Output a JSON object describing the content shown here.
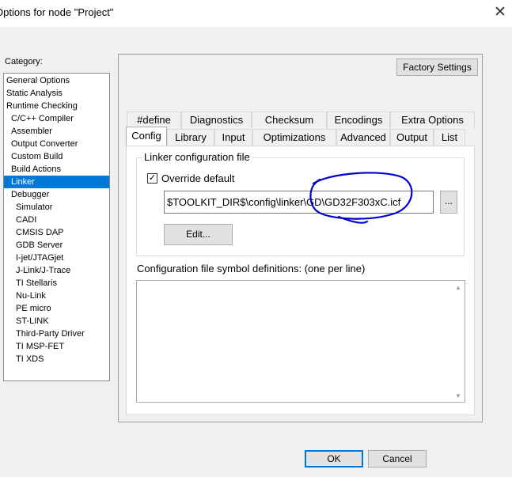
{
  "window": {
    "title": "Options for node \"Project\"",
    "close_glyph": "✕"
  },
  "category": {
    "label": "Category:",
    "items": [
      {
        "label": "General Options",
        "indent": 0
      },
      {
        "label": "Static Analysis",
        "indent": 0
      },
      {
        "label": "Runtime Checking",
        "indent": 0
      },
      {
        "label": "C/C++ Compiler",
        "indent": 1
      },
      {
        "label": "Assembler",
        "indent": 1
      },
      {
        "label": "Output Converter",
        "indent": 1
      },
      {
        "label": "Custom Build",
        "indent": 1
      },
      {
        "label": "Build Actions",
        "indent": 1
      },
      {
        "label": "Linker",
        "indent": 1,
        "selected": true
      },
      {
        "label": "Debugger",
        "indent": 1
      },
      {
        "label": "Simulator",
        "indent": 2
      },
      {
        "label": "CADI",
        "indent": 2
      },
      {
        "label": "CMSIS DAP",
        "indent": 2
      },
      {
        "label": "GDB Server",
        "indent": 2
      },
      {
        "label": "I-jet/JTAGjet",
        "indent": 2
      },
      {
        "label": "J-Link/J-Trace",
        "indent": 2
      },
      {
        "label": "TI Stellaris",
        "indent": 2
      },
      {
        "label": "Nu-Link",
        "indent": 2
      },
      {
        "label": "PE micro",
        "indent": 2
      },
      {
        "label": "ST-LINK",
        "indent": 2
      },
      {
        "label": "Third-Party Driver",
        "indent": 2
      },
      {
        "label": "TI MSP-FET",
        "indent": 2
      },
      {
        "label": "TI XDS",
        "indent": 2
      }
    ]
  },
  "factory_settings_label": "Factory Settings",
  "tabs_row1": [
    "#define",
    "Diagnostics",
    "Checksum",
    "Encodings",
    "Extra Options"
  ],
  "tabs_row2": [
    "Config",
    "Library",
    "Input",
    "Optimizations",
    "Advanced",
    "Output",
    "List"
  ],
  "active_tab": "Config",
  "config": {
    "group_title": "Linker configuration file",
    "override_checked": true,
    "override_label": "Override default",
    "checkmark": "✓",
    "config_file_path": "$TOOLKIT_DIR$\\config\\linker\\GD\\GD32F303xC.icf",
    "browse_label": "...",
    "edit_label": "Edit...",
    "symbol_defs_label": "Configuration file symbol definitions: (one per line)",
    "symbol_defs_value": "",
    "scroll_up_glyph": "▲",
    "scroll_down_glyph": "▼"
  },
  "buttons": {
    "ok": "OK",
    "cancel": "Cancel"
  },
  "annotation": {
    "color": "#0000cc"
  },
  "colors": {
    "selection": "#0078d7",
    "window_bg": "#f0f0f0",
    "focus_border": "#0078d7"
  }
}
